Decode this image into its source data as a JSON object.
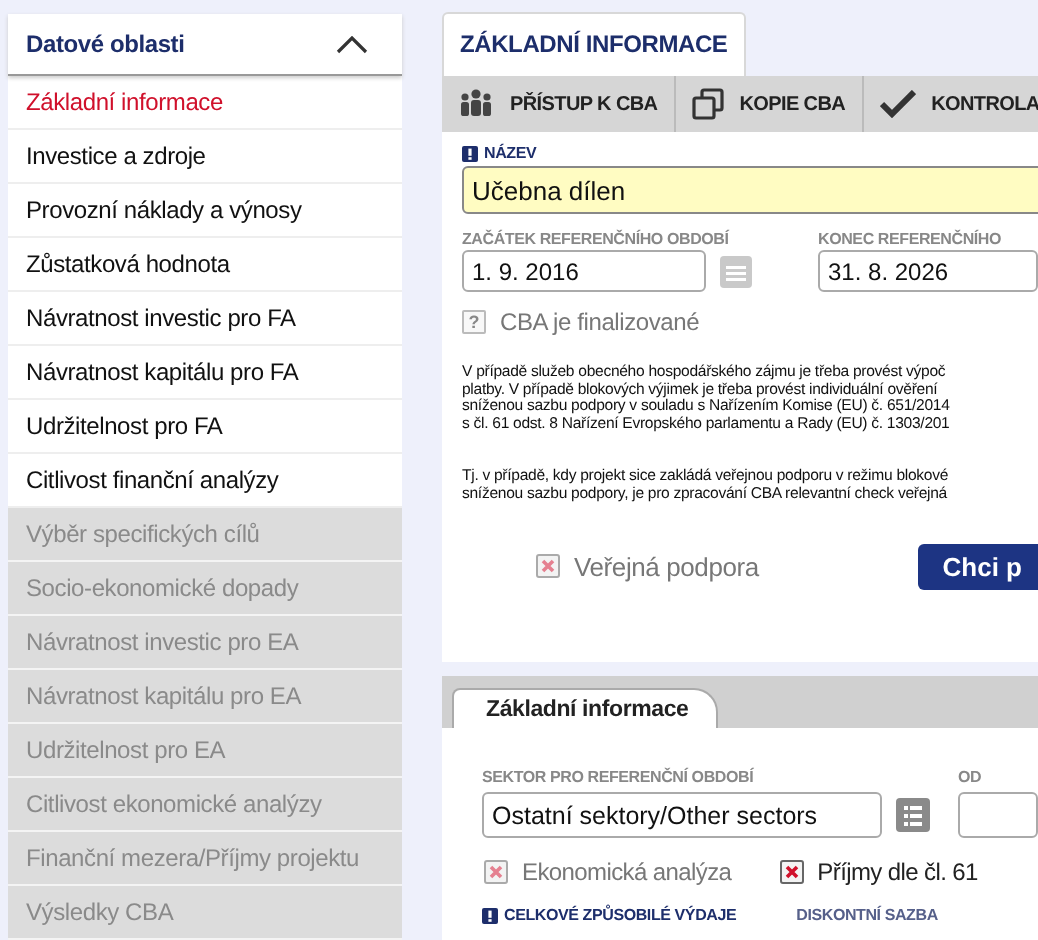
{
  "sidebar": {
    "title": "Datové oblasti",
    "expanded": true,
    "items": [
      {
        "label": "Základní informace",
        "selected": true,
        "disabled": false
      },
      {
        "label": "Investice a zdroje",
        "selected": false,
        "disabled": false
      },
      {
        "label": "Provozní náklady a výnosy",
        "selected": false,
        "disabled": false
      },
      {
        "label": "Zůstatková hodnota",
        "selected": false,
        "disabled": false
      },
      {
        "label": "Návratnost investic pro FA",
        "selected": false,
        "disabled": false
      },
      {
        "label": "Návratnost kapitálu pro FA",
        "selected": false,
        "disabled": false
      },
      {
        "label": "Udržitelnost pro FA",
        "selected": false,
        "disabled": false
      },
      {
        "label": "Citlivost finanční analýzy",
        "selected": false,
        "disabled": false
      },
      {
        "label": "Výběr specifických cílů",
        "selected": false,
        "disabled": true
      },
      {
        "label": "Socio-ekonomické dopady",
        "selected": false,
        "disabled": true
      },
      {
        "label": "Návratnost investic pro EA",
        "selected": false,
        "disabled": true
      },
      {
        "label": "Návratnost kapitálu pro EA",
        "selected": false,
        "disabled": true
      },
      {
        "label": "Udržitelnost pro EA",
        "selected": false,
        "disabled": true
      },
      {
        "label": "Citlivost ekonomické analýzy",
        "selected": false,
        "disabled": true
      },
      {
        "label": "Finanční mezera/Příjmy projektu",
        "selected": false,
        "disabled": true
      },
      {
        "label": "Výsledky CBA",
        "selected": false,
        "disabled": true
      }
    ]
  },
  "main_tab": {
    "label": "ZÁKLADNÍ INFORMACE"
  },
  "toolbar": [
    {
      "kind": "people",
      "label": "PŘÍSTUP K CBA"
    },
    {
      "kind": "copy",
      "label": "KOPIE CBA"
    },
    {
      "kind": "check",
      "label": "KONTROLA"
    }
  ],
  "name_field": {
    "label": "NÁZEV",
    "required": true,
    "value": "Učebna dílen"
  },
  "period_start": {
    "label": "ZAČÁTEK REFERENČNÍHO OBDOBÍ",
    "value": "1. 9. 2016"
  },
  "period_end": {
    "label": "KONEC REFERENČNÍHO",
    "value": "31. 8. 2026"
  },
  "finalized": {
    "label": "CBA je finalizované",
    "mark": "?",
    "disabled": true
  },
  "notes": [
    [
      "V případě služeb obecného hospodářského zájmu je třeba provést výpoč",
      "platby. V případě blokových výjimek je třeba provést individuální ověření",
      "sníženou sazbu podpory v souladu s Nařízením Komise (EU) č. 651/2014",
      "s čl. 61 odst. 8 Nařízení Evropského parlamentu a Rady (EU) č. 1303/201"
    ],
    [
      "Tj. v případě, kdy projekt sice zakládá veřejnou podporu v režimu blokové",
      "sníženou sazbu podpory, je pro zpracování CBA relevantní check veřejná"
    ]
  ],
  "public_support": {
    "label": "Veřejná podpora",
    "checked": false,
    "disabled": true
  },
  "submit_button": {
    "label": "Chci p"
  },
  "section_tab": {
    "label": "Základní informace"
  },
  "sector_field": {
    "label": "SEKTOR PRO REFERENČNÍ OBDOBÍ",
    "value": "Ostatní sektory/Other sectors"
  },
  "from_field": {
    "label": "OD"
  },
  "checks": [
    {
      "label": "Ekonomická analýza",
      "checked": false,
      "disabled": true
    },
    {
      "label": "Příjmy dle čl. 61",
      "checked": false,
      "disabled": false
    }
  ],
  "bottom_labels": [
    {
      "label": "CELKOVÉ ZPŮSOBILÉ VÝDAJE",
      "required": true
    },
    {
      "label": "DISKONTNÍ SAZBA",
      "required": false
    }
  ]
}
